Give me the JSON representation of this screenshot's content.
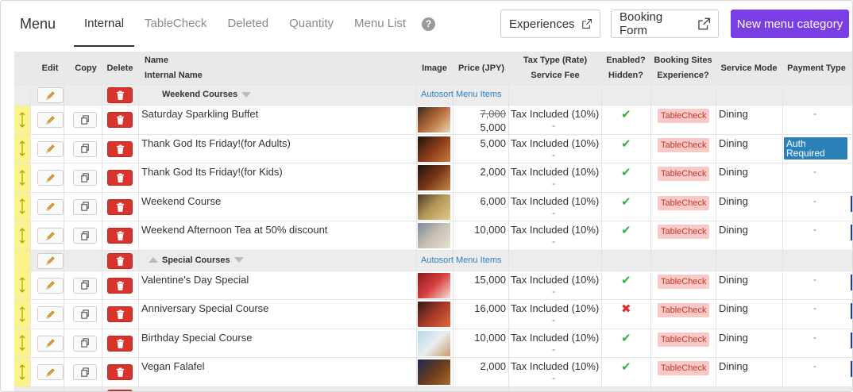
{
  "header": {
    "title": "Menu",
    "tabs": [
      "Internal",
      "TableCheck",
      "Deleted",
      "Quantity",
      "Menu List"
    ],
    "help_icon": "?",
    "experiences_label": "Experiences",
    "booking_form_label": "Booking Form",
    "new_category_label": "New menu category"
  },
  "columns": {
    "edit": "Edit",
    "copy": "Copy",
    "delete": "Delete",
    "name": "Name",
    "internal_name": "Internal Name",
    "image": "Image",
    "price": "Price (JPY)",
    "tax_type": "Tax Type (Rate)",
    "service_fee": "Service Fee",
    "enabled": "Enabled?",
    "hidden": "Hidden?",
    "booking_sites": "Booking Sites",
    "experience": "Experience?",
    "service_mode": "Service Mode",
    "payment_type": "Payment Type"
  },
  "categories": [
    {
      "name": "Weekend Courses",
      "autosort": "Autosort Menu Items",
      "items": [
        {
          "name": "Saturday Sparkling Buffet",
          "old_price": "7,000",
          "price": "5,000",
          "tax": "Tax Included (10%)",
          "fee": "-",
          "enabled": "✔",
          "site": "TableCheck",
          "mode": "Dining",
          "payment": "-"
        },
        {
          "name": "Thank God Its Friday!(for Adults)",
          "price": "5,000",
          "tax": "Tax Included (10%)",
          "fee": "-",
          "enabled": "✔",
          "site": "TableCheck",
          "mode": "Dining",
          "payment": "Auth Required"
        },
        {
          "name": "Thank God Its Friday!(for Kids)",
          "price": "2,000",
          "tax": "Tax Included (10%)",
          "fee": "-",
          "enabled": "✔",
          "site": "TableCheck",
          "mode": "Dining",
          "payment": "-"
        },
        {
          "name": "Weekend Course",
          "price": "6,000",
          "tax": "Tax Included (10%)",
          "fee": "-",
          "enabled": "✔",
          "site": "TableCheck",
          "mode": "Dining",
          "payment": "-"
        },
        {
          "name": "Weekend Afternoon Tea at 50% discount",
          "price": "10,000",
          "tax": "Tax Included (10%)",
          "fee": "-",
          "enabled": "✔",
          "site": "TableCheck",
          "mode": "Dining",
          "payment": "-"
        }
      ]
    },
    {
      "name": "Special Courses",
      "autosort": "Autosort Menu Items",
      "items": [
        {
          "name": "Valentine's Day Special",
          "price": "15,000",
          "tax": "Tax Included (10%)",
          "fee": "-",
          "enabled": "✔",
          "site": "TableCheck",
          "mode": "Dining",
          "payment": "-"
        },
        {
          "name": "Anniversary Special Course",
          "price": "16,000",
          "tax": "Tax Included (10%)",
          "fee": "-",
          "enabled": "✖",
          "site": "TableCheck",
          "mode": "Dining",
          "payment": "-"
        },
        {
          "name": "Birthday Special Course",
          "price": "10,000",
          "tax": "Tax Included (10%)",
          "fee": "-",
          "enabled": "✔",
          "site": "TableCheck",
          "mode": "Dining",
          "payment": "-"
        },
        {
          "name": "Vegan Falafel",
          "price": "2,000",
          "tax": "Tax Included (10%)",
          "fee": "-",
          "enabled": "✔",
          "site": "TableCheck",
          "mode": "Dining",
          "payment": "-"
        }
      ]
    }
  ],
  "colors": {
    "accent": "#7a3fe4",
    "delete": "#d9342b",
    "drag_handle": "#f8f38a",
    "badge_bg": "#f8c9c6",
    "auth_bg": "#2c80b8"
  }
}
